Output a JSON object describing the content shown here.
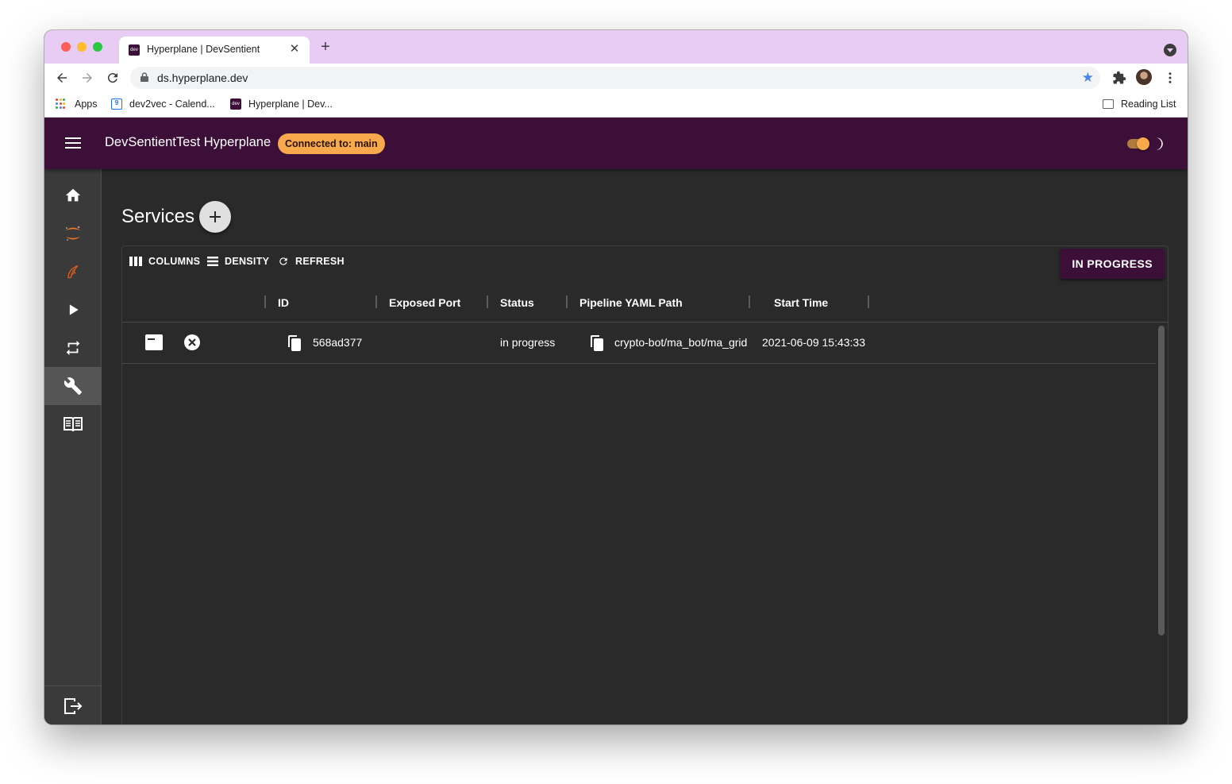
{
  "browser": {
    "tab_title": "Hyperplane | DevSentient",
    "tab_favicon_text": "dev",
    "url": "ds.hyperplane.dev",
    "bookmarks": [
      {
        "label": "Apps"
      },
      {
        "label": "dev2vec - Calend..."
      },
      {
        "label": "Hyperplane | Dev..."
      }
    ],
    "calendar_icon_text": "9",
    "reading_list_label": "Reading List"
  },
  "appbar": {
    "title": "DevSentientTest Hyperplane",
    "connection_chip": "Connected to: main",
    "accent_color": "#3b0f38",
    "chip_color": "#f7a94b"
  },
  "sidebar": {
    "items": [
      {
        "icon": "home-icon"
      },
      {
        "icon": "jupyter-icon"
      },
      {
        "icon": "spark-icon"
      },
      {
        "icon": "play-icon"
      },
      {
        "icon": "repeat-icon"
      },
      {
        "icon": "wrench-icon",
        "active": true
      },
      {
        "icon": "book-icon"
      }
    ],
    "footer_icon": "logout-icon"
  },
  "page": {
    "title": "Services"
  },
  "grid": {
    "toolbar": {
      "columns": "COLUMNS",
      "density": "DENSITY",
      "refresh": "REFRESH",
      "filter_button": "IN PROGRESS"
    },
    "columns": [
      "ID",
      "Exposed Port",
      "Status",
      "Pipeline YAML Path",
      "Start Time"
    ],
    "rows": [
      {
        "id": "568ad377",
        "exposed_port": "",
        "status": "in progress",
        "pipeline_yaml_path": "crypto-bot/ma_bot/ma_grid",
        "start_time": "2021-06-09 15:43:33"
      }
    ]
  }
}
